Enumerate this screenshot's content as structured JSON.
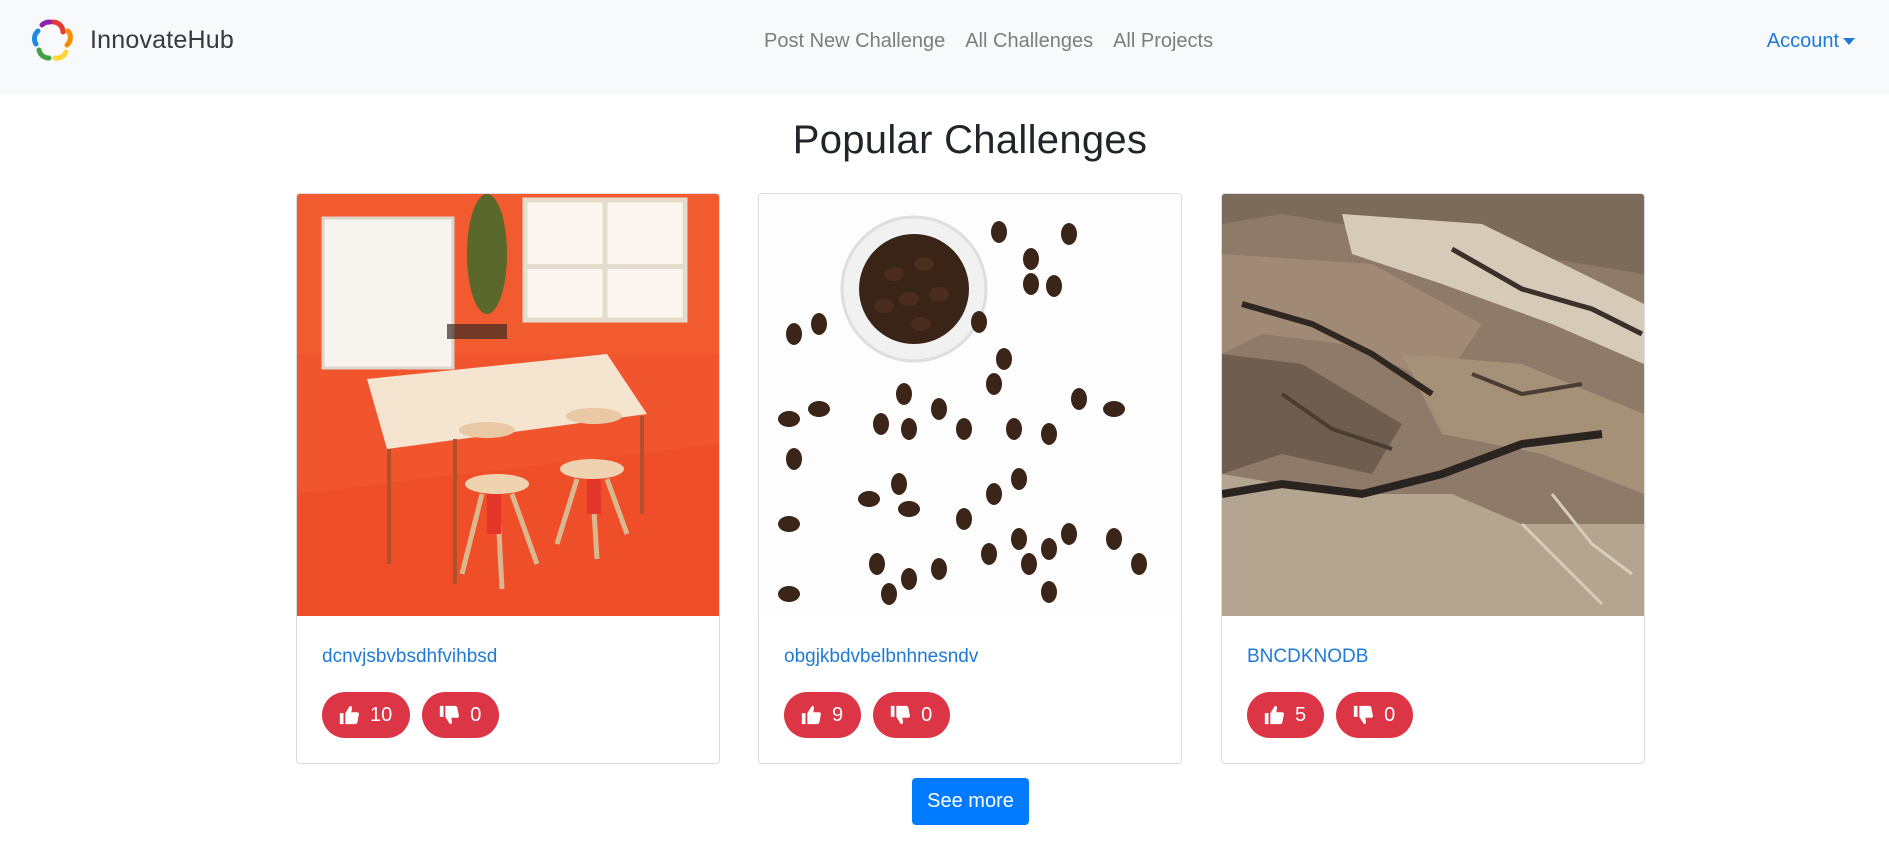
{
  "navbar": {
    "brand": "InnovateHub",
    "links": [
      "Post New Challenge",
      "All Challenges",
      "All Projects"
    ],
    "account_label": "Account"
  },
  "main": {
    "title": "Popular Challenges",
    "cards": [
      {
        "title": "dcnvjsbvbsdhfvihbsd",
        "likes": "10",
        "dislikes": "0",
        "image": "orange meeting room with table and stools"
      },
      {
        "title": "obgjkbdvbelbnhnesndv",
        "likes": "9",
        "dislikes": "0",
        "image": "coffee beans and glass cup on white"
      },
      {
        "title": "BNCDKNODB",
        "likes": "5",
        "dislikes": "0",
        "image": "aerial desert mountains"
      }
    ],
    "see_more_label": "See more"
  },
  "colors": {
    "navbar_bg": "#f8f9fa",
    "link_blue": "#1f7ad6",
    "vote_red": "#dc3545",
    "primary_button": "#007bff"
  }
}
